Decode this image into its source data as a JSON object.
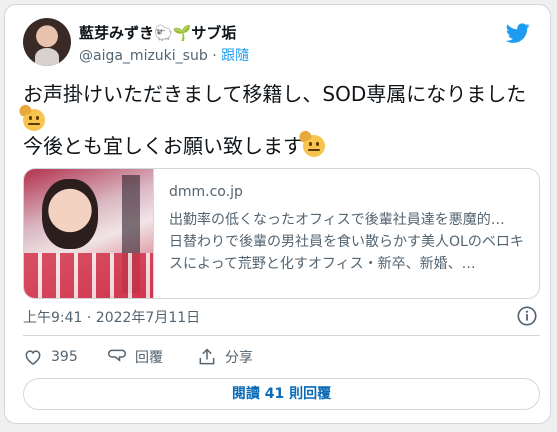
{
  "author": {
    "display_name": "藍芽みずき🐑🌱サブ垢",
    "handle": "@aiga_mizuki_sub",
    "separator": "·",
    "follow_label": "跟隨"
  },
  "tweet": {
    "line1": "お声掛けいただきまして移籍し、SOD専属になりました",
    "line2": "今後とも宜しくお願い致します"
  },
  "link_card": {
    "domain": "dmm.co.jp",
    "title": "出勤率の低くなったオフィスで後輩社員達を悪魔的…",
    "description": "日替わりで後輩の男社員を食い散らかす美人OLのベロキスによって荒野と化すオフィス・新卒、新婚、…"
  },
  "timestamp": "上午9:41 · 2022年7月11日",
  "actions": {
    "like_count": "395",
    "reply_label": "回覆",
    "share_label": "分享"
  },
  "read_replies": {
    "prefix": "閱讀 ",
    "count": "41",
    "suffix": " 則回覆"
  },
  "icons": [
    "twitter-bird-icon",
    "emoji-icon",
    "info-icon",
    "heart-icon",
    "reply-icon",
    "share-icon"
  ],
  "colors": {
    "accent": "#1d9bf0",
    "muted": "#536471",
    "border": "#cfd9de"
  }
}
